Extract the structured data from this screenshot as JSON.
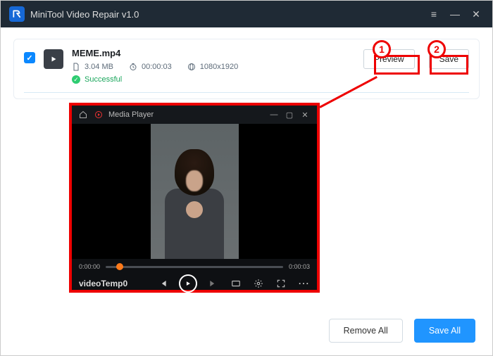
{
  "window": {
    "title": "MiniTool Video Repair v1.0"
  },
  "file": {
    "name": "MEME.mp4",
    "size": "3.04 MB",
    "duration": "00:00:03",
    "resolution": "1080x1920",
    "status": "Successful"
  },
  "actions": {
    "preview": "Preview",
    "save": "Save"
  },
  "player": {
    "title": "Media Player",
    "current": "0:00:00",
    "total": "0:00:03",
    "videoName": "videoTemp0"
  },
  "footer": {
    "remove_all": "Remove All",
    "save_all": "Save All"
  },
  "callouts": {
    "one": "1",
    "two": "2"
  }
}
